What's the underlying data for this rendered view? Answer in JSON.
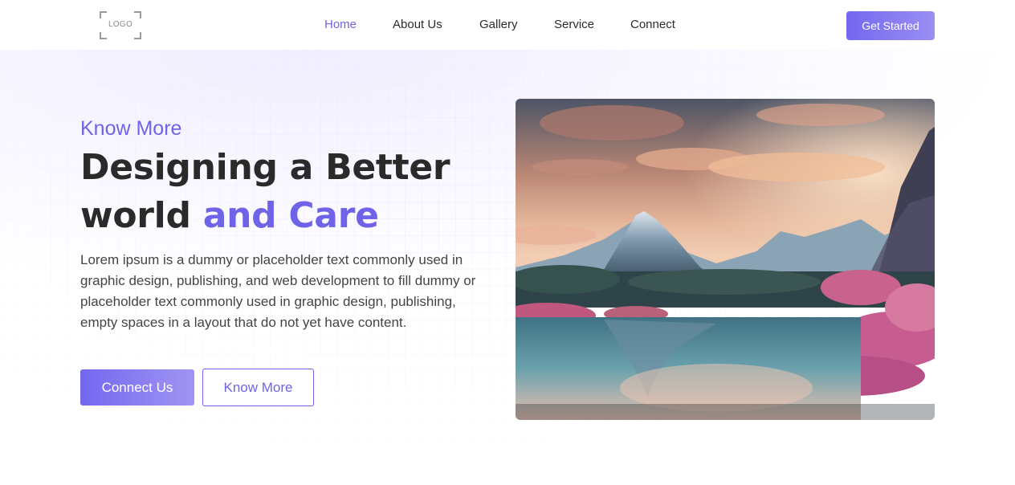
{
  "header": {
    "logo_text": "LOGO",
    "nav": [
      {
        "label": "Home",
        "active": true
      },
      {
        "label": "About Us",
        "active": false
      },
      {
        "label": "Gallery",
        "active": false
      },
      {
        "label": "Service",
        "active": false
      },
      {
        "label": "Connect",
        "active": false
      }
    ],
    "cta_label": "Get Started"
  },
  "hero": {
    "eyebrow": "Know More",
    "headline_line1": "Designing a Better",
    "headline_line2_plain": "world ",
    "headline_line2_accent": "and Care",
    "description": "Lorem ipsum is a dummy or placeholder text commonly used in graphic design, publishing, and web development to fill dummy or placeholder text commonly used in graphic design, publishing, empty spaces in a layout that do not yet have content.",
    "primary_button": "Connect Us",
    "secondary_button": "Know More",
    "image_icon": "landscape-image"
  },
  "colors": {
    "accent": "#6f63e8",
    "text_dark": "#2a2a2a",
    "text_body": "#444444",
    "background": "#ffffff"
  }
}
